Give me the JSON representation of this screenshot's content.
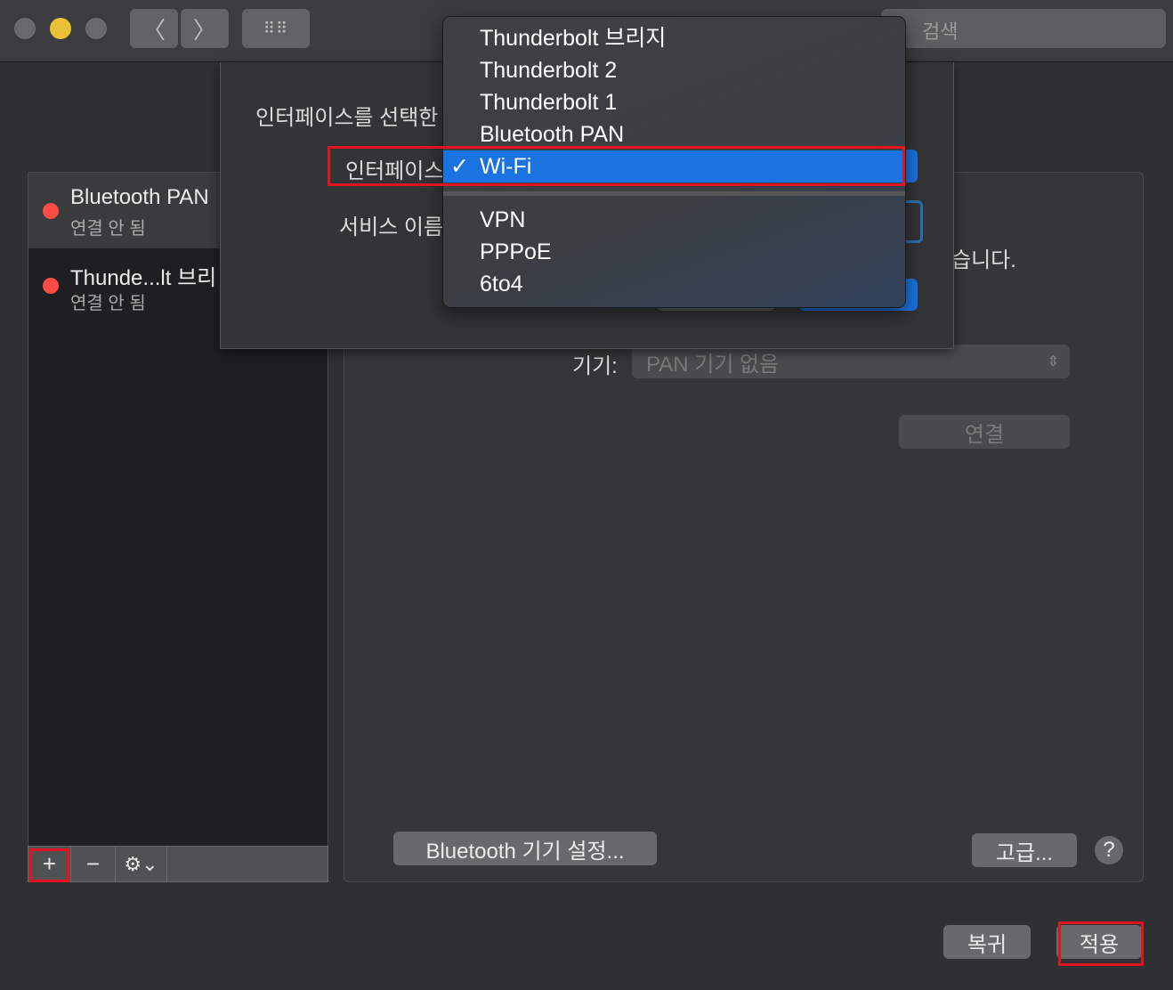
{
  "toolbar": {
    "back_icon": "chevron-left-icon",
    "forward_icon": "chevron-right-icon",
    "grid_icon": "grid-icon",
    "search_placeholder": "검색"
  },
  "sidebar": {
    "items": [
      {
        "name": "Bluetooth PAN",
        "status": "연결 안 됨",
        "status_color": "#fe4b43",
        "selected": true
      },
      {
        "name": "Thunde...lt 브리",
        "status": "연결 안 됨",
        "status_color": "#fe4b43",
        "selected": false
      }
    ],
    "add_label": "+",
    "remove_label": "−",
    "gear_label": "⚙︎⌄"
  },
  "main": {
    "partial_text": "습니다.",
    "device_label": "기기:",
    "device_value": "PAN 기기 없음",
    "connect_label": "연결",
    "bt_setup_label": "Bluetooth 기기 설정...",
    "advanced_label": "고급...",
    "help_label": "?"
  },
  "sheet": {
    "prompt": "인터페이스를 선택한",
    "interface_label": "인터페이스",
    "service_label": "서비스 이름"
  },
  "menu": {
    "items": [
      "Thunderbolt 브리지",
      "Thunderbolt 2",
      "Thunderbolt 1",
      "Bluetooth PAN",
      "Wi-Fi"
    ],
    "selected": "Wi-Fi",
    "check": "✓",
    "items2": [
      "VPN",
      "PPPoE",
      "6to4"
    ]
  },
  "footer": {
    "revert_label": "복귀",
    "apply_label": "적용"
  },
  "colors": {
    "accent": "#1a73e0",
    "highlight": "#e3141f"
  }
}
